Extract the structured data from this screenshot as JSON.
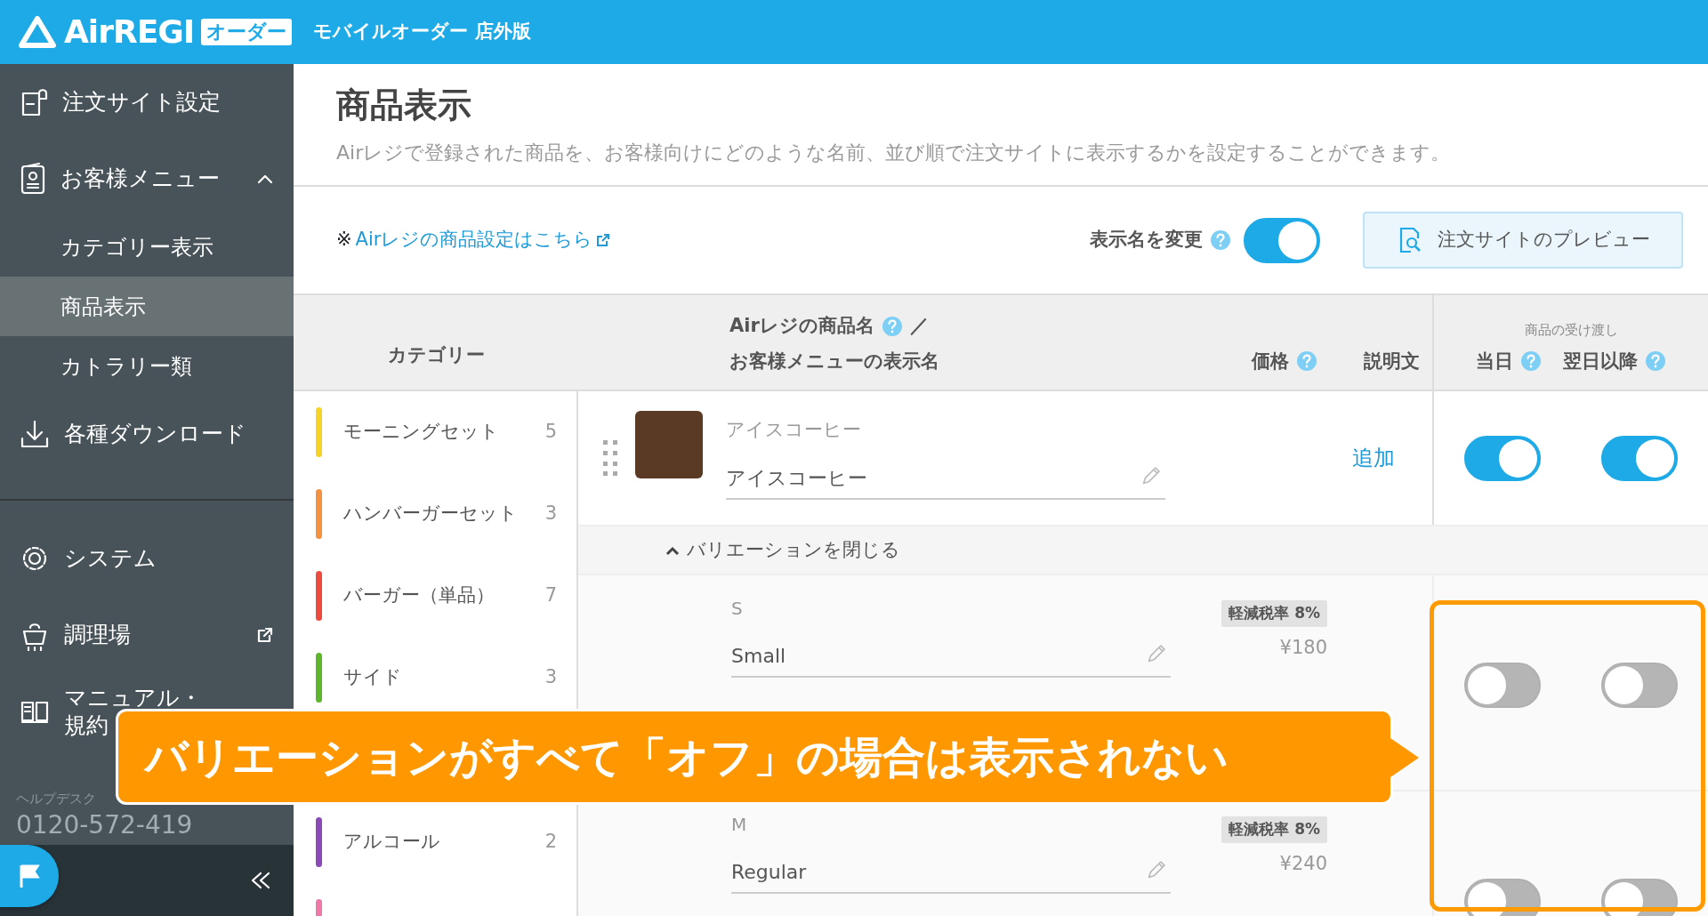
{
  "header": {
    "logo_text": "AirREGI",
    "logo_badge": "オーダー",
    "product_name": "モバイルオーダー 店外版"
  },
  "sidebar": {
    "items": [
      {
        "label": "注文サイト設定"
      },
      {
        "label": "お客様メニュー",
        "expanded": true,
        "children": [
          {
            "label": "カテゴリー表示",
            "selected": false
          },
          {
            "label": "商品表示",
            "selected": true
          },
          {
            "label": "カトラリー類",
            "selected": false
          }
        ]
      },
      {
        "label": "各種ダウンロード"
      }
    ],
    "bottom_items": [
      {
        "label": "システム",
        "external": false
      },
      {
        "label": "調理場",
        "external": true
      },
      {
        "label": "マニュアル・規約",
        "external": false
      }
    ],
    "helpdesk": {
      "label": "ヘルプデスク",
      "phone": "0120-572-419"
    }
  },
  "page": {
    "title": "商品表示",
    "description": "Airレジで登録された商品を、お客様向けにどのような名前、並び順で注文サイトに表示するかを設定することができます。"
  },
  "toolbar": {
    "link_prefix": "※",
    "link": "Airレジの商品設定はこちら",
    "rename_label": "表示名を変更",
    "rename_on": true,
    "preview_button": "注文サイトのプレビュー"
  },
  "table": {
    "columns": {
      "category": "カテゴリー",
      "name_line1": "Airレジの商品名",
      "name_separator": "／",
      "name_line2": "お客様メニューの表示名",
      "price": "価格",
      "description": "説明文",
      "delivery_group": "商品の受け渡し",
      "same_day": "当日",
      "next_day": "翌日以降"
    },
    "categories": [
      {
        "name": "モーニングセット",
        "count": "5",
        "color": "#f5d327"
      },
      {
        "name": "ハンバーガーセット",
        "count": "3",
        "color": "#f39241"
      },
      {
        "name": "バーガー（単品）",
        "count": "7",
        "color": "#ee4b3f"
      },
      {
        "name": "サイド",
        "count": "3",
        "color": "#5fb52c"
      },
      {
        "name": "アルコール",
        "count": "2",
        "color": "#8a4bb8"
      },
      {
        "color": "#ef7aa8"
      }
    ],
    "product": {
      "original_name": "アイスコーヒー",
      "display_name": "アイスコーヒー",
      "description_link": "追加",
      "same_day": true,
      "next_day": true,
      "variations_toggle": "バリエーションを閉じる",
      "variations_expanded": true
    },
    "variations": [
      {
        "label": "S",
        "display_name": "Small",
        "tax_badge": "軽減税率 8%",
        "price": "¥180",
        "same_day": false,
        "next_day": false
      },
      {
        "label": "M",
        "display_name": "Regular",
        "tax_badge": "軽減税率 8%",
        "price": "¥240",
        "same_day": false,
        "next_day": false
      }
    ]
  },
  "callout": {
    "text": "バリエーションがすべて「オフ」の場合は表示されない"
  }
}
